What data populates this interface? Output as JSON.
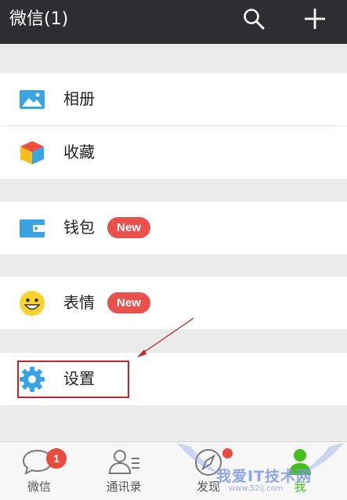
{
  "header": {
    "title": "微信(1)",
    "actions": [
      {
        "icon": "search-icon"
      },
      {
        "icon": "plus-icon"
      }
    ]
  },
  "menu": {
    "album_label": "相册",
    "favorites_label": "收藏",
    "wallet_label": "钱包",
    "wallet_badge": "New",
    "stickers_label": "表情",
    "stickers_badge": "New",
    "settings_label": "设置"
  },
  "bottom_tabs": [
    {
      "label": "微信",
      "icon": "chat-bubble-icon",
      "badge": "1"
    },
    {
      "label": "通讯录",
      "icon": "contacts-icon"
    },
    {
      "label": "发现",
      "icon": "compass-icon",
      "dot": true
    },
    {
      "label": "我",
      "icon": "person-icon",
      "active": true
    }
  ],
  "watermark": {
    "text": "我爱IT技术网",
    "url": "www.52ij.com"
  },
  "colors": {
    "header_bg": "#2c2e31",
    "badge_red": "#e9514d",
    "active_green": "#45c01a",
    "highlight_red": "#c0262b",
    "icon_blue": "#3aa3e3"
  }
}
